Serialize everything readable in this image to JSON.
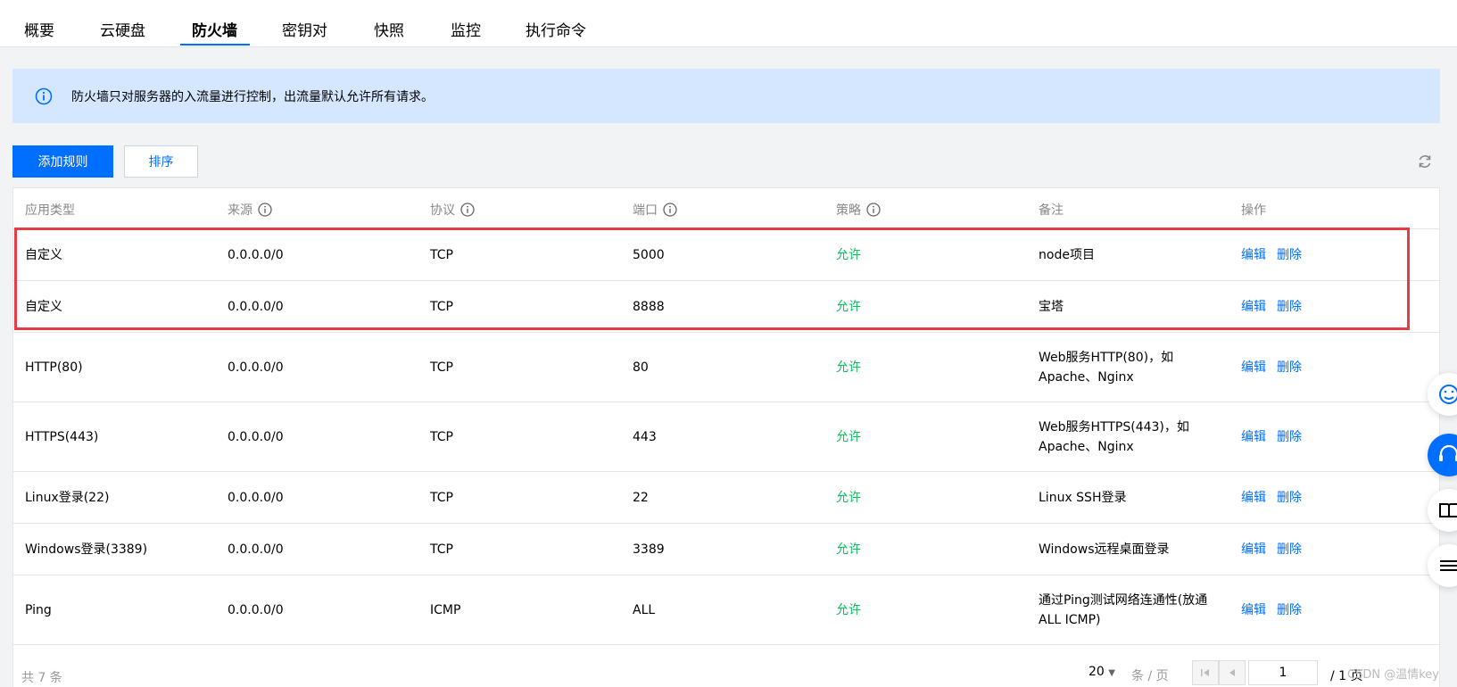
{
  "tabs": [
    {
      "label": "概要"
    },
    {
      "label": "云硬盘"
    },
    {
      "label": "防火墙"
    },
    {
      "label": "密钥对"
    },
    {
      "label": "快照"
    },
    {
      "label": "监控"
    },
    {
      "label": "执行命令"
    }
  ],
  "notice": {
    "text": "防火墙只对服务器的入流量进行控制，出流量默认允许所有请求。"
  },
  "toolbar": {
    "add_label": "添加规则",
    "sort_label": "排序"
  },
  "table": {
    "headers": [
      "应用类型",
      "来源",
      "协议",
      "端口",
      "策略",
      "备注",
      "操作"
    ],
    "rows": [
      {
        "app": "自定义",
        "source": "0.0.0.0/0",
        "protocol": "TCP",
        "port": "5000",
        "policy": "允许",
        "note": "node项目",
        "edit": "编辑",
        "delete": "删除"
      },
      {
        "app": "自定义",
        "source": "0.0.0.0/0",
        "protocol": "TCP",
        "port": "8888",
        "policy": "允许",
        "note": "宝塔",
        "edit": "编辑",
        "delete": "删除"
      },
      {
        "app": "HTTP(80)",
        "source": "0.0.0.0/0",
        "protocol": "TCP",
        "port": "80",
        "policy": "允许",
        "note": "Web服务HTTP(80)，如Apache、Nginx",
        "edit": "编辑",
        "delete": "删除"
      },
      {
        "app": "HTTPS(443)",
        "source": "0.0.0.0/0",
        "protocol": "TCP",
        "port": "443",
        "policy": "允许",
        "note": "Web服务HTTPS(443)，如Apache、Nginx",
        "edit": "编辑",
        "delete": "删除"
      },
      {
        "app": "Linux登录(22)",
        "source": "0.0.0.0/0",
        "protocol": "TCP",
        "port": "22",
        "policy": "允许",
        "note": "Linux SSH登录",
        "edit": "编辑",
        "delete": "删除"
      },
      {
        "app": "Windows登录(3389)",
        "source": "0.0.0.0/0",
        "protocol": "TCP",
        "port": "3389",
        "policy": "允许",
        "note": "Windows远程桌面登录",
        "edit": "编辑",
        "delete": "删除"
      },
      {
        "app": "Ping",
        "source": "0.0.0.0/0",
        "protocol": "ICMP",
        "port": "ALL",
        "policy": "允许",
        "note": "通过Ping测试网络连通性(放通ALL ICMP)",
        "edit": "编辑",
        "delete": "删除"
      }
    ]
  },
  "footer": {
    "total": "共 7 条",
    "page_size": "20",
    "page_size_unit": "条 / 页",
    "page_input": "1",
    "page_total": "/ 1 页"
  },
  "watermark": "CSDN @温情key",
  "colors": {
    "accent": "#006eff",
    "allow": "#0abf5b",
    "highlight": "#e53d46",
    "notice_bg": "#d5e7ff"
  }
}
